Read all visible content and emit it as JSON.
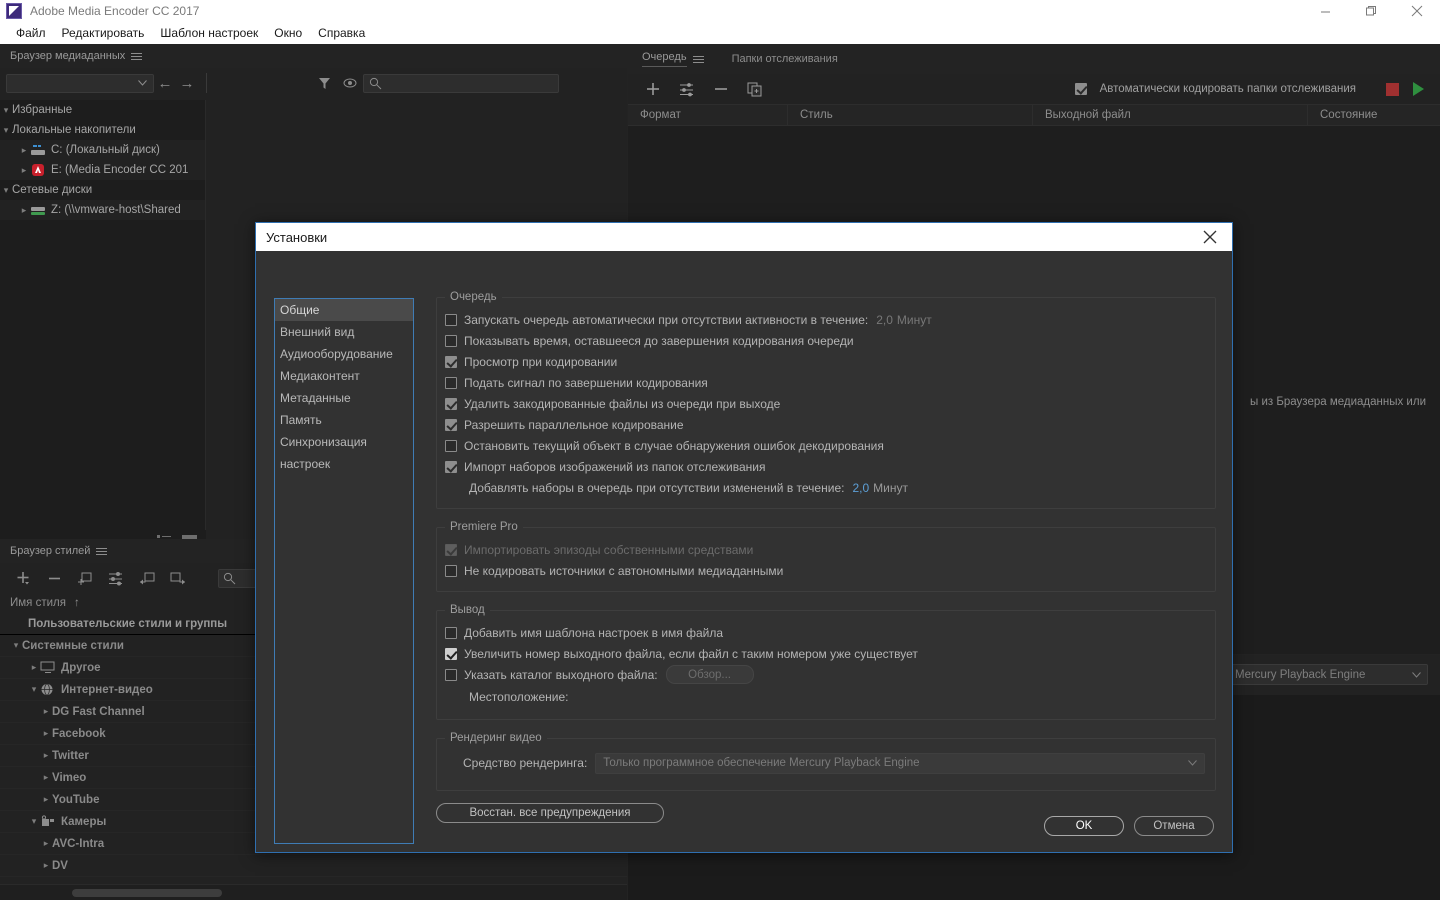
{
  "window": {
    "title": "Adobe Media Encoder CC 2017",
    "controls": {
      "minimize": "minimize-icon",
      "maximize": "maximize-icon",
      "close": "close-icon"
    }
  },
  "menubar": {
    "items": [
      {
        "label": "Файл"
      },
      {
        "label": "Редактировать"
      },
      {
        "label": "Шаблон настроек"
      },
      {
        "label": "Окно"
      },
      {
        "label": "Справка"
      }
    ]
  },
  "media_browser": {
    "tab": "Браузер медиаданных",
    "menu_icon": "hamburger-icon",
    "select_value": "",
    "back_icon": "arrow-left-icon",
    "forward_icon": "arrow-right-icon",
    "filter_icon": "funnel-icon",
    "preview_icon": "eye-icon",
    "search_placeholder": "",
    "search_icon": "search-icon",
    "tree": [
      {
        "label": "Избранные",
        "level": 1,
        "twisty": "chevron-down",
        "icon": null
      },
      {
        "label": "Локальные накопители",
        "level": 1,
        "twisty": "chevron-down",
        "icon": null
      },
      {
        "label": "C: (Локальный диск)",
        "level": 2,
        "twisty": "chevron-right",
        "icon": "hard-drive-icon"
      },
      {
        "label": "E: (Media Encoder CC 201",
        "level": 2,
        "twisty": "chevron-right",
        "icon": "adobe-disc-icon"
      },
      {
        "label": "Сетевые диски",
        "level": 1,
        "twisty": "chevron-down",
        "icon": null
      },
      {
        "label": "Z: (\\\\vmware-host\\Shared",
        "level": 2,
        "twisty": "chevron-right",
        "icon": "network-drive-icon"
      }
    ],
    "view_list_icon": "list-view-icon",
    "view_thumb_icon": "thumbnail-view-icon"
  },
  "preset_browser": {
    "tab": "Браузер стилей",
    "menu_icon": "hamburger-icon",
    "toolbar": [
      {
        "name": "new-preset-icon",
        "glyph": "+"
      },
      {
        "name": "delete-preset-icon",
        "glyph": "−"
      },
      {
        "name": "new-group-icon",
        "glyph": "group"
      },
      {
        "name": "preset-settings-icon",
        "glyph": "sliders"
      },
      {
        "name": "import-preset-icon",
        "glyph": "import"
      },
      {
        "name": "export-preset-icon",
        "glyph": "export"
      }
    ],
    "search_icon": "search-icon",
    "column_header": "Имя стиля",
    "sort_icon": "sort-asc-icon",
    "rows": [
      {
        "label": "Пользовательские стили и группы",
        "level": 0,
        "twisty": "",
        "icon": null,
        "header": true
      },
      {
        "label": "Системные стили",
        "level": 0,
        "twisty": "chevron-down",
        "icon": null
      },
      {
        "label": "Другое",
        "level": 1,
        "twisty": "chevron-right",
        "icon": "monitor-icon"
      },
      {
        "label": "Интернет-видео",
        "level": 1,
        "twisty": "chevron-down",
        "icon": "globe-icon"
      },
      {
        "label": "DG Fast Channel",
        "level": 2,
        "twisty": "chevron-right",
        "icon": null
      },
      {
        "label": "Facebook",
        "level": 2,
        "twisty": "chevron-right",
        "icon": null
      },
      {
        "label": "Twitter",
        "level": 2,
        "twisty": "chevron-right",
        "icon": null
      },
      {
        "label": "Vimeo",
        "level": 2,
        "twisty": "chevron-right",
        "icon": null
      },
      {
        "label": "YouTube",
        "level": 2,
        "twisty": "chevron-right",
        "icon": null
      },
      {
        "label": "Камеры",
        "level": 1,
        "twisty": "chevron-down",
        "icon": "camera-icon"
      },
      {
        "label": "AVC-Intra",
        "level": 2,
        "twisty": "chevron-right",
        "icon": null
      },
      {
        "label": "DV",
        "level": 2,
        "twisty": "chevron-right",
        "icon": null
      }
    ]
  },
  "queue": {
    "tabs": [
      {
        "label": "Очередь",
        "active": true
      },
      {
        "label": "Папки отслеживания",
        "active": false
      }
    ],
    "menu_icon": "hamburger-icon",
    "toolbar": [
      {
        "name": "add-item-icon",
        "glyph": "+"
      },
      {
        "name": "add-preset-icon",
        "glyph": "sliders"
      },
      {
        "name": "remove-item-icon",
        "glyph": "−"
      },
      {
        "name": "duplicate-item-icon",
        "glyph": "duplicate"
      }
    ],
    "auto_encode_label": "Автоматически кодировать папки отслеживания",
    "auto_encode_checked": true,
    "stop_button": "stop-icon",
    "start_button": "start-queue-icon",
    "columns": [
      "Формат",
      "Стиль",
      "Выходной файл",
      "Состояние"
    ],
    "hint_text": "ы из Браузера медиаданных или"
  },
  "encoding_panel": {
    "renderer_value": "Mercury Playback Engine",
    "chevron_icon": "chevron-down-icon"
  },
  "dialog": {
    "title": "Установки",
    "close_icon": "close-icon",
    "sidebar": [
      {
        "label": "Общие",
        "selected": true
      },
      {
        "label": "Внешний вид",
        "selected": false
      },
      {
        "label": "Аудиооборудование",
        "selected": false
      },
      {
        "label": "Медиаконтент",
        "selected": false
      },
      {
        "label": "Метаданные",
        "selected": false
      },
      {
        "label": "Память",
        "selected": false
      },
      {
        "label": "Синхронизация настроек",
        "selected": false
      }
    ],
    "groups": {
      "queue": {
        "legend": "Очередь",
        "items": [
          {
            "label": "Запускать очередь автоматически при отсутствии активности в течение:",
            "checked": false,
            "value": "2,0",
            "unit": "Минут",
            "value_active": false
          },
          {
            "label": "Показывать время, оставшееся до завершения кодирования очереди",
            "checked": false
          },
          {
            "label": "Просмотр при кодировании",
            "checked": true
          },
          {
            "label": "Подать сигнал по завершении кодирования",
            "checked": false
          },
          {
            "label": "Удалить закодированные файлы из очереди при выходе",
            "checked": true
          },
          {
            "label": "Разрешить параллельное кодирование",
            "checked": true
          },
          {
            "label": "Остановить текущий объект в случае обнаружения ошибок декодирования",
            "checked": false
          },
          {
            "label": "Импорт наборов изображений из папок отслеживания",
            "checked": true
          }
        ],
        "sub_row": {
          "label": "Добавлять наборы в очередь при отсутствии изменений в течение:",
          "value": "2,0",
          "unit": "Минут"
        }
      },
      "premiere": {
        "legend": "Premiere Pro",
        "items": [
          {
            "label": "Импортировать эпизоды собственными средствами",
            "checked": true,
            "disabled": true
          },
          {
            "label": "Не кодировать источники с автономными медиаданными",
            "checked": false
          }
        ]
      },
      "output": {
        "legend": "Вывод",
        "items": [
          {
            "label": "Добавить имя шаблона настроек в имя файла",
            "checked": false
          },
          {
            "label": "Увеличить номер выходного файла, если файл с таким номером уже существует",
            "checked": true,
            "bright": true
          },
          {
            "label": "Указать каталог выходного файла:",
            "checked": false,
            "button": "Обзор..."
          }
        ],
        "location_label": "Местоположение:"
      },
      "render": {
        "legend": "Рендеринг видео",
        "label": "Средство рендеринга:",
        "value": "Только программное обеспечение Mercury Playback Engine",
        "chevron_icon": "chevron-down-icon"
      }
    },
    "reset_warnings_button": "Восстан. все предупреждения",
    "ok_button": "OK",
    "cancel_button": "Отмена"
  },
  "colors": {
    "dialog_border": "#2f6fb0",
    "sidebar_border": "#3f7cb5",
    "accent_value": "#5d9fd6",
    "stop": "#a03030",
    "start": "#2f8f3f"
  }
}
